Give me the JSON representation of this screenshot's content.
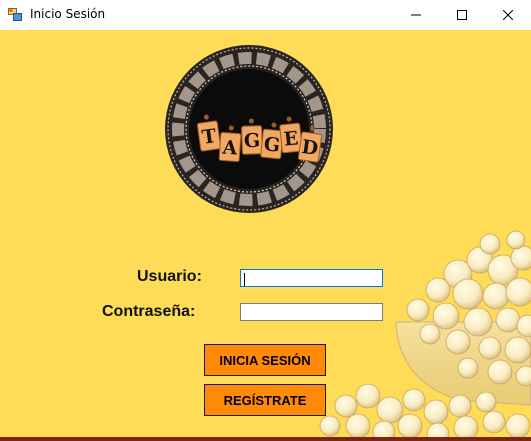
{
  "window": {
    "title": "Inicio Sesión",
    "icon": "winforms-app-icon",
    "controls": [
      "minimize-icon",
      "maximize-icon",
      "close-icon"
    ]
  },
  "logo": {
    "letters": [
      "T",
      "A",
      "G",
      "G",
      "E",
      "D"
    ],
    "icon": "film-reel-logo"
  },
  "form": {
    "username_label": "Usuario:",
    "username_value": "",
    "password_label": "Contraseña:",
    "password_value": ""
  },
  "buttons": {
    "login_label": "INICIA SESIÓN",
    "register_label": "REGÍSTRATE"
  },
  "decor": {
    "image": "popcorn-bowl"
  },
  "colors": {
    "background": "#fedc58",
    "button": "#ff8a08",
    "reel_outer": "#2a2420",
    "reel_inner": "#0b0b0b",
    "tag": "#f2a865"
  }
}
